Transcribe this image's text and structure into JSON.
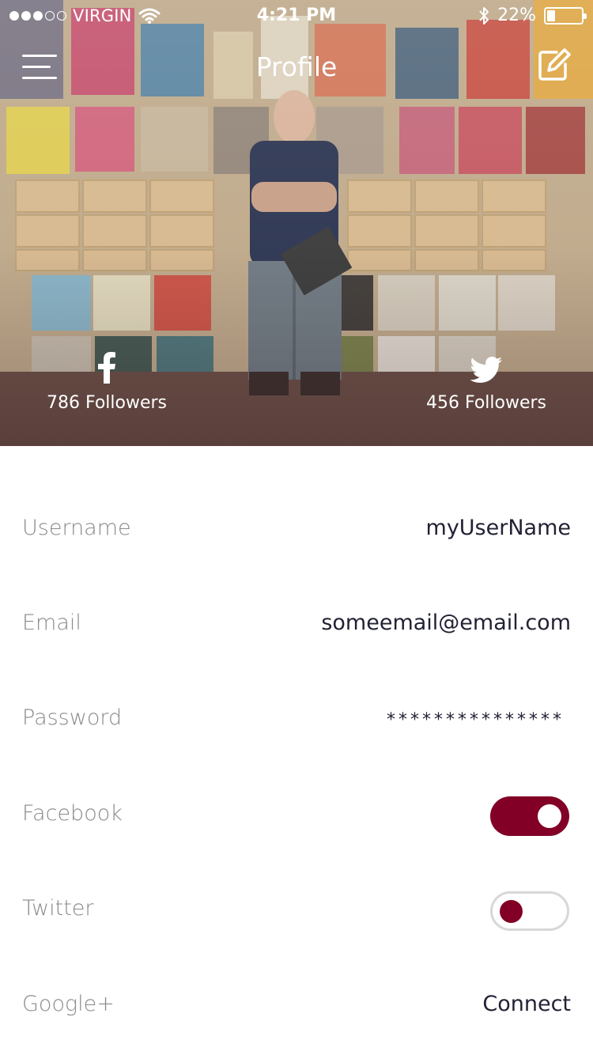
{
  "status_bar": {
    "carrier": "VIRGIN",
    "time": "4:21 PM",
    "battery": "22%",
    "signal_dots_filled": 3,
    "signal_dots_total": 5,
    "battery_level": 0.22,
    "icons": [
      "signal-icon",
      "wifi-icon",
      "bluetooth-icon",
      "battery-icon"
    ]
  },
  "nav": {
    "title": "Profile",
    "left_icon": "menu-icon",
    "right_icon": "edit-icon"
  },
  "social": {
    "facebook": {
      "icon": "facebook-icon",
      "followers": "786 Followers"
    },
    "twitter": {
      "icon": "twitter-icon",
      "followers": "456 Followers"
    }
  },
  "profile": {
    "username": {
      "label": "Username",
      "value": "myUserName"
    },
    "email": {
      "label": "Email",
      "value": "someemail@email.com"
    },
    "password": {
      "label": "Password",
      "value": "***************"
    },
    "facebook": {
      "label": "Facebook",
      "enabled": true
    },
    "twitter": {
      "label": "Twitter",
      "enabled": false
    },
    "google": {
      "label": "Google+",
      "action": "Connect"
    }
  },
  "colors": {
    "accent": "#820025",
    "label": "#8a8a8a",
    "value": "#222235",
    "toggle_off_border": "#d8d8d8"
  }
}
